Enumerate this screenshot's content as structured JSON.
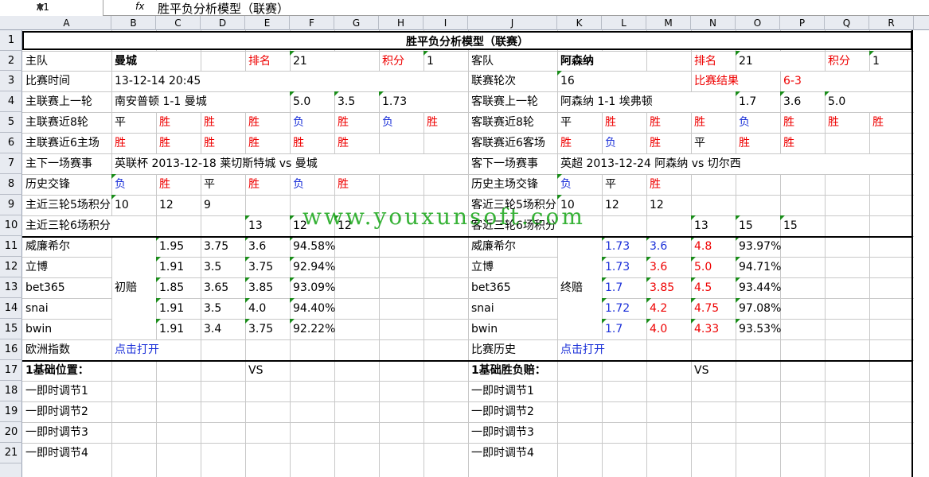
{
  "formula_bar": {
    "name_box": "A1",
    "fx": "fx",
    "content": "胜平负分析模型（联赛）"
  },
  "columns": [
    "A",
    "B",
    "C",
    "D",
    "E",
    "F",
    "G",
    "H",
    "I",
    "J",
    "K",
    "L",
    "M",
    "N",
    "O",
    "P",
    "Q",
    "R"
  ],
  "rows": [
    "1",
    "2",
    "3",
    "4",
    "5",
    "6",
    "7",
    "8",
    "9",
    "10",
    "11",
    "12",
    "13",
    "14",
    "15",
    "16",
    "17",
    "18",
    "19",
    "20",
    "21"
  ],
  "sheet": {
    "title": "胜平负分析模型（联赛）",
    "r2": {
      "home_label": "主队",
      "home": "曼城",
      "rank_label": "排名",
      "home_rank": "21",
      "points_label": "积分",
      "home_points": "1",
      "away_label": "客队",
      "away": "阿森纳",
      "away_rank_label": "排名",
      "away_rank": "21",
      "away_points_label": "积分",
      "away_points": "1"
    },
    "r3": {
      "time_label": "比赛时间",
      "time": "13-12-14 20:45",
      "round_label": "联赛轮次",
      "round": "16",
      "result_label": "比赛结果",
      "result": "6-3"
    },
    "r4": {
      "home_last_label": "主联赛上一轮",
      "home_last": "南安普顿 1-1 曼城",
      "h1": "5.0",
      "h2": "3.5",
      "h3": "1.73",
      "away_last_label": "客联赛上一轮",
      "away_last": "阿森纳 1-1 埃弗顿",
      "a1": "1.7",
      "a2": "3.6",
      "a3": "5.0"
    },
    "r5": {
      "label": "主联赛近8轮",
      "home": [
        "平",
        "胜",
        "胜",
        "胜",
        "负",
        "胜",
        "负",
        "胜"
      ],
      "away_label": "客联赛近8轮",
      "away": [
        "平",
        "胜",
        "胜",
        "胜",
        "负",
        "胜",
        "胜",
        "胜"
      ]
    },
    "r6": {
      "label": "主联赛近6主场",
      "home": [
        "胜",
        "胜",
        "胜",
        "胜",
        "胜",
        "胜"
      ],
      "away_label": "客联赛近6客场",
      "away": [
        "胜",
        "负",
        "胜",
        "平",
        "胜",
        "胜"
      ]
    },
    "r7": {
      "label": "主下一场赛事",
      "home": "英联杯 2013-12-18 莱切斯特城 vs 曼城",
      "away_label": "客下一场赛事",
      "away": "英超 2013-12-24 阿森纳 vs 切尔西"
    },
    "r8": {
      "label": "历史交锋",
      "home": [
        "负",
        "胜",
        "平",
        "胜",
        "负",
        "胜"
      ],
      "away_label": "历史主场交锋",
      "away": [
        "负",
        "平",
        "胜"
      ]
    },
    "r9": {
      "label": "主近三轮5场积分",
      "home": [
        "10",
        "12",
        "9"
      ],
      "away_label": "客近三轮5场积分",
      "away": [
        "10",
        "12",
        "12"
      ]
    },
    "r10": {
      "label": "主近三轮6场积分",
      "home": [
        "13",
        "12",
        "12"
      ],
      "away_label": "客近三轮6场积分",
      "away": [
        "13",
        "15",
        "15"
      ]
    },
    "odds_initial_label": "初赔",
    "odds_final_label": "终赔",
    "odds": [
      {
        "book": "威廉希尔",
        "i1": "1.95",
        "i2": "3.75",
        "i3": "3.6",
        "ip": "94.58%",
        "f1": "1.73",
        "f2": "3.6",
        "f3": "4.8",
        "fp": "93.97%"
      },
      {
        "book": "立博",
        "i1": "1.91",
        "i2": "3.5",
        "i3": "3.75",
        "ip": "92.94%",
        "f1": "1.73",
        "f2": "3.6",
        "f3": "5.0",
        "fp": "94.71%"
      },
      {
        "book": "bet365",
        "i1": "1.85",
        "i2": "3.65",
        "i3": "3.85",
        "ip": "93.09%",
        "f1": "1.7",
        "f2": "3.85",
        "f3": "4.5",
        "fp": "93.44%"
      },
      {
        "book": "snai",
        "i1": "1.91",
        "i2": "3.5",
        "i3": "4.0",
        "ip": "94.40%",
        "f1": "1.72",
        "f2": "4.2",
        "f3": "4.75",
        "fp": "97.08%"
      },
      {
        "book": "bwin",
        "i1": "1.91",
        "i2": "3.4",
        "i3": "3.75",
        "ip": "92.22%",
        "f1": "1.7",
        "f2": "4.0",
        "f3": "4.33",
        "fp": "93.53%"
      }
    ],
    "r16": {
      "label": "欧洲指数",
      "link": "点击打开",
      "away_label": "比赛历史",
      "away_link": "点击打开"
    },
    "r17": {
      "label": "1基础位置：",
      "vs": "VS",
      "away_label": "1基础胜负赔：",
      "away_vs": "VS"
    },
    "adjust": [
      "一即时调节1",
      "一即时调节2",
      "一即时调节3",
      "一即时调节4"
    ],
    "watermark": "www.youxunsoft.com"
  }
}
